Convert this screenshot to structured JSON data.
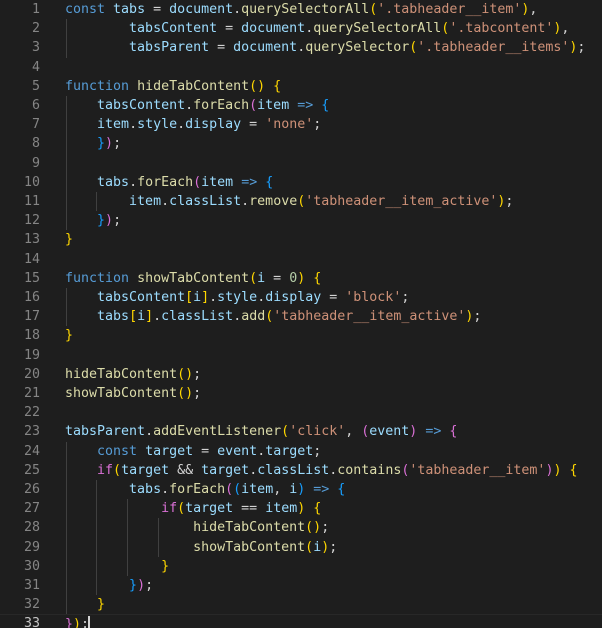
{
  "editor": {
    "theme": "dark-plus",
    "language": "javascript",
    "background": "#1e1e1e",
    "gutter_color": "#858585",
    "active_line_number": 33,
    "cursor": {
      "line": 33,
      "column": 4
    },
    "total_lines": 33,
    "colors": {
      "keyword": "#569cd6",
      "variable": "#9cdcfe",
      "function": "#dcdcaa",
      "string": "#ce9178",
      "number": "#b5cea8",
      "plain": "#d4d4d4",
      "paren_level_1": "#ffd700",
      "paren_level_2": "#da70d6",
      "paren_level_3": "#179fff",
      "indent_guide": "#404040",
      "cursor": "#d4d4d4"
    }
  },
  "lines": [
    {
      "n": 1,
      "guides": [],
      "tokens": [
        {
          "t": "const",
          "c": "t-kw"
        },
        {
          "t": " ",
          "c": "t-plain"
        },
        {
          "t": "tabs",
          "c": "t-var"
        },
        {
          "t": " = ",
          "c": "t-plain"
        },
        {
          "t": "document",
          "c": "t-var"
        },
        {
          "t": ".",
          "c": "t-plain"
        },
        {
          "t": "querySelectorAll",
          "c": "t-fn"
        },
        {
          "t": "(",
          "c": "t-p1"
        },
        {
          "t": "'.tabheader__item'",
          "c": "t-str"
        },
        {
          "t": ")",
          "c": "t-p1"
        },
        {
          "t": ",",
          "c": "t-plain"
        }
      ]
    },
    {
      "n": 2,
      "guides": [
        1
      ],
      "tokens": [
        {
          "t": "        ",
          "c": "t-plain"
        },
        {
          "t": "tabsContent",
          "c": "t-var"
        },
        {
          "t": " = ",
          "c": "t-plain"
        },
        {
          "t": "document",
          "c": "t-var"
        },
        {
          "t": ".",
          "c": "t-plain"
        },
        {
          "t": "querySelectorAll",
          "c": "t-fn"
        },
        {
          "t": "(",
          "c": "t-p1"
        },
        {
          "t": "'.tabcontent'",
          "c": "t-str"
        },
        {
          "t": ")",
          "c": "t-p1"
        },
        {
          "t": ",",
          "c": "t-plain"
        }
      ]
    },
    {
      "n": 3,
      "guides": [
        1
      ],
      "tokens": [
        {
          "t": "        ",
          "c": "t-plain"
        },
        {
          "t": "tabsParent",
          "c": "t-var"
        },
        {
          "t": " = ",
          "c": "t-plain"
        },
        {
          "t": "document",
          "c": "t-var"
        },
        {
          "t": ".",
          "c": "t-plain"
        },
        {
          "t": "querySelector",
          "c": "t-fn"
        },
        {
          "t": "(",
          "c": "t-p1"
        },
        {
          "t": "'.tabheader__items'",
          "c": "t-str"
        },
        {
          "t": ")",
          "c": "t-p1"
        },
        {
          "t": ";",
          "c": "t-plain"
        }
      ]
    },
    {
      "n": 4,
      "guides": [],
      "tokens": []
    },
    {
      "n": 5,
      "guides": [],
      "tokens": [
        {
          "t": "function",
          "c": "t-kw"
        },
        {
          "t": " ",
          "c": "t-plain"
        },
        {
          "t": "hideTabContent",
          "c": "t-fn"
        },
        {
          "t": "()",
          "c": "t-p1"
        },
        {
          "t": " ",
          "c": "t-plain"
        },
        {
          "t": "{",
          "c": "t-p1"
        }
      ]
    },
    {
      "n": 6,
      "guides": [
        1
      ],
      "tokens": [
        {
          "t": "    ",
          "c": "t-plain"
        },
        {
          "t": "tabsContent",
          "c": "t-var"
        },
        {
          "t": ".",
          "c": "t-plain"
        },
        {
          "t": "forEach",
          "c": "t-fn"
        },
        {
          "t": "(",
          "c": "t-p2"
        },
        {
          "t": "item",
          "c": "t-var"
        },
        {
          "t": " ",
          "c": "t-plain"
        },
        {
          "t": "=>",
          "c": "t-kw"
        },
        {
          "t": " ",
          "c": "t-plain"
        },
        {
          "t": "{",
          "c": "t-p3"
        }
      ]
    },
    {
      "n": 7,
      "guides": [
        1
      ],
      "tokens": [
        {
          "t": "    ",
          "c": "t-plain"
        },
        {
          "t": "item",
          "c": "t-var"
        },
        {
          "t": ".",
          "c": "t-plain"
        },
        {
          "t": "style",
          "c": "t-var"
        },
        {
          "t": ".",
          "c": "t-plain"
        },
        {
          "t": "display",
          "c": "t-var"
        },
        {
          "t": " = ",
          "c": "t-plain"
        },
        {
          "t": "'none'",
          "c": "t-str"
        },
        {
          "t": ";",
          "c": "t-plain"
        }
      ]
    },
    {
      "n": 8,
      "guides": [
        1
      ],
      "tokens": [
        {
          "t": "    ",
          "c": "t-plain"
        },
        {
          "t": "}",
          "c": "t-p3"
        },
        {
          "t": ")",
          "c": "t-p2"
        },
        {
          "t": ";",
          "c": "t-plain"
        }
      ]
    },
    {
      "n": 9,
      "guides": [
        1
      ],
      "tokens": []
    },
    {
      "n": 10,
      "guides": [
        1
      ],
      "tokens": [
        {
          "t": "    ",
          "c": "t-plain"
        },
        {
          "t": "tabs",
          "c": "t-var"
        },
        {
          "t": ".",
          "c": "t-plain"
        },
        {
          "t": "forEach",
          "c": "t-fn"
        },
        {
          "t": "(",
          "c": "t-p2"
        },
        {
          "t": "item",
          "c": "t-var"
        },
        {
          "t": " ",
          "c": "t-plain"
        },
        {
          "t": "=>",
          "c": "t-kw"
        },
        {
          "t": " ",
          "c": "t-plain"
        },
        {
          "t": "{",
          "c": "t-p3"
        }
      ]
    },
    {
      "n": 11,
      "guides": [
        1,
        2
      ],
      "tokens": [
        {
          "t": "        ",
          "c": "t-plain"
        },
        {
          "t": "item",
          "c": "t-var"
        },
        {
          "t": ".",
          "c": "t-plain"
        },
        {
          "t": "classList",
          "c": "t-var"
        },
        {
          "t": ".",
          "c": "t-plain"
        },
        {
          "t": "remove",
          "c": "t-fn"
        },
        {
          "t": "(",
          "c": "t-p1"
        },
        {
          "t": "'tabheader__item_active'",
          "c": "t-str"
        },
        {
          "t": ")",
          "c": "t-p1"
        },
        {
          "t": ";",
          "c": "t-plain"
        }
      ]
    },
    {
      "n": 12,
      "guides": [
        1
      ],
      "tokens": [
        {
          "t": "    ",
          "c": "t-plain"
        },
        {
          "t": "}",
          "c": "t-p3"
        },
        {
          "t": ")",
          "c": "t-p2"
        },
        {
          "t": ";",
          "c": "t-plain"
        }
      ]
    },
    {
      "n": 13,
      "guides": [],
      "tokens": [
        {
          "t": "}",
          "c": "t-p1"
        }
      ]
    },
    {
      "n": 14,
      "guides": [],
      "tokens": []
    },
    {
      "n": 15,
      "guides": [],
      "tokens": [
        {
          "t": "function",
          "c": "t-kw"
        },
        {
          "t": " ",
          "c": "t-plain"
        },
        {
          "t": "showTabContent",
          "c": "t-fn"
        },
        {
          "t": "(",
          "c": "t-p1"
        },
        {
          "t": "i",
          "c": "t-var"
        },
        {
          "t": " = ",
          "c": "t-plain"
        },
        {
          "t": "0",
          "c": "t-num"
        },
        {
          "t": ")",
          "c": "t-p1"
        },
        {
          "t": " ",
          "c": "t-plain"
        },
        {
          "t": "{",
          "c": "t-p1"
        }
      ]
    },
    {
      "n": 16,
      "guides": [
        1
      ],
      "tokens": [
        {
          "t": "    ",
          "c": "t-plain"
        },
        {
          "t": "tabsContent",
          "c": "t-var"
        },
        {
          "t": "[",
          "c": "t-p1"
        },
        {
          "t": "i",
          "c": "t-var"
        },
        {
          "t": "]",
          "c": "t-p1"
        },
        {
          "t": ".",
          "c": "t-plain"
        },
        {
          "t": "style",
          "c": "t-var"
        },
        {
          "t": ".",
          "c": "t-plain"
        },
        {
          "t": "display",
          "c": "t-var"
        },
        {
          "t": " = ",
          "c": "t-plain"
        },
        {
          "t": "'block'",
          "c": "t-str"
        },
        {
          "t": ";",
          "c": "t-plain"
        }
      ]
    },
    {
      "n": 17,
      "guides": [
        1
      ],
      "tokens": [
        {
          "t": "    ",
          "c": "t-plain"
        },
        {
          "t": "tabs",
          "c": "t-var"
        },
        {
          "t": "[",
          "c": "t-p1"
        },
        {
          "t": "i",
          "c": "t-var"
        },
        {
          "t": "]",
          "c": "t-p1"
        },
        {
          "t": ".",
          "c": "t-plain"
        },
        {
          "t": "classList",
          "c": "t-var"
        },
        {
          "t": ".",
          "c": "t-plain"
        },
        {
          "t": "add",
          "c": "t-fn"
        },
        {
          "t": "(",
          "c": "t-p1"
        },
        {
          "t": "'tabheader__item_active'",
          "c": "t-str"
        },
        {
          "t": ")",
          "c": "t-p1"
        },
        {
          "t": ";",
          "c": "t-plain"
        }
      ]
    },
    {
      "n": 18,
      "guides": [],
      "tokens": [
        {
          "t": "}",
          "c": "t-p1"
        }
      ]
    },
    {
      "n": 19,
      "guides": [],
      "tokens": []
    },
    {
      "n": 20,
      "guides": [],
      "tokens": [
        {
          "t": "hideTabContent",
          "c": "t-fn"
        },
        {
          "t": "()",
          "c": "t-p1"
        },
        {
          "t": ";",
          "c": "t-plain"
        }
      ]
    },
    {
      "n": 21,
      "guides": [],
      "tokens": [
        {
          "t": "showTabContent",
          "c": "t-fn"
        },
        {
          "t": "()",
          "c": "t-p1"
        },
        {
          "t": ";",
          "c": "t-plain"
        }
      ]
    },
    {
      "n": 22,
      "guides": [],
      "tokens": []
    },
    {
      "n": 23,
      "guides": [],
      "tokens": [
        {
          "t": "tabsParent",
          "c": "t-var"
        },
        {
          "t": ".",
          "c": "t-plain"
        },
        {
          "t": "addEventListener",
          "c": "t-fn"
        },
        {
          "t": "(",
          "c": "t-p1"
        },
        {
          "t": "'click'",
          "c": "t-str"
        },
        {
          "t": ", ",
          "c": "t-plain"
        },
        {
          "t": "(",
          "c": "t-p2"
        },
        {
          "t": "event",
          "c": "t-var"
        },
        {
          "t": ")",
          "c": "t-p2"
        },
        {
          "t": " ",
          "c": "t-plain"
        },
        {
          "t": "=>",
          "c": "t-kw"
        },
        {
          "t": " ",
          "c": "t-plain"
        },
        {
          "t": "{",
          "c": "t-p2"
        }
      ]
    },
    {
      "n": 24,
      "guides": [
        1
      ],
      "tokens": [
        {
          "t": "    ",
          "c": "t-plain"
        },
        {
          "t": "const",
          "c": "t-kw"
        },
        {
          "t": " ",
          "c": "t-plain"
        },
        {
          "t": "target",
          "c": "t-var"
        },
        {
          "t": " = ",
          "c": "t-plain"
        },
        {
          "t": "event",
          "c": "t-var"
        },
        {
          "t": ".",
          "c": "t-plain"
        },
        {
          "t": "target",
          "c": "t-var"
        },
        {
          "t": ";",
          "c": "t-plain"
        }
      ]
    },
    {
      "n": 25,
      "guides": [
        1
      ],
      "tokens": [
        {
          "t": "    ",
          "c": "t-plain"
        },
        {
          "t": "if",
          "c": "t-p2"
        },
        {
          "t": "(",
          "c": "t-p1"
        },
        {
          "t": "target",
          "c": "t-var"
        },
        {
          "t": " && ",
          "c": "t-plain"
        },
        {
          "t": "target",
          "c": "t-var"
        },
        {
          "t": ".",
          "c": "t-plain"
        },
        {
          "t": "classList",
          "c": "t-var"
        },
        {
          "t": ".",
          "c": "t-plain"
        },
        {
          "t": "contains",
          "c": "t-fn"
        },
        {
          "t": "(",
          "c": "t-p2"
        },
        {
          "t": "'tabheader__item'",
          "c": "t-str"
        },
        {
          "t": ")",
          "c": "t-p2"
        },
        {
          "t": ")",
          "c": "t-p1"
        },
        {
          "t": " ",
          "c": "t-plain"
        },
        {
          "t": "{",
          "c": "t-p1"
        }
      ]
    },
    {
      "n": 26,
      "guides": [
        1,
        2
      ],
      "tokens": [
        {
          "t": "        ",
          "c": "t-plain"
        },
        {
          "t": "tabs",
          "c": "t-var"
        },
        {
          "t": ".",
          "c": "t-plain"
        },
        {
          "t": "forEach",
          "c": "t-fn"
        },
        {
          "t": "(",
          "c": "t-p2"
        },
        {
          "t": "(",
          "c": "t-p3"
        },
        {
          "t": "item",
          "c": "t-var"
        },
        {
          "t": ", ",
          "c": "t-plain"
        },
        {
          "t": "i",
          "c": "t-var"
        },
        {
          "t": ")",
          "c": "t-p3"
        },
        {
          "t": " ",
          "c": "t-plain"
        },
        {
          "t": "=>",
          "c": "t-kw"
        },
        {
          "t": " ",
          "c": "t-plain"
        },
        {
          "t": "{",
          "c": "t-p3"
        }
      ]
    },
    {
      "n": 27,
      "guides": [
        1,
        2,
        3
      ],
      "tokens": [
        {
          "t": "            ",
          "c": "t-plain"
        },
        {
          "t": "if",
          "c": "t-p2"
        },
        {
          "t": "(",
          "c": "t-p1"
        },
        {
          "t": "target",
          "c": "t-var"
        },
        {
          "t": " == ",
          "c": "t-plain"
        },
        {
          "t": "item",
          "c": "t-var"
        },
        {
          "t": ")",
          "c": "t-p1"
        },
        {
          "t": " ",
          "c": "t-plain"
        },
        {
          "t": "{",
          "c": "t-p1"
        }
      ]
    },
    {
      "n": 28,
      "guides": [
        1,
        2,
        3,
        4
      ],
      "tokens": [
        {
          "t": "                ",
          "c": "t-plain"
        },
        {
          "t": "hideTabContent",
          "c": "t-fn"
        },
        {
          "t": "()",
          "c": "t-p1"
        },
        {
          "t": ";",
          "c": "t-plain"
        }
      ]
    },
    {
      "n": 29,
      "guides": [
        1,
        2,
        3,
        4
      ],
      "tokens": [
        {
          "t": "                ",
          "c": "t-plain"
        },
        {
          "t": "showTabContent",
          "c": "t-fn"
        },
        {
          "t": "(",
          "c": "t-p1"
        },
        {
          "t": "i",
          "c": "t-var"
        },
        {
          "t": ")",
          "c": "t-p1"
        },
        {
          "t": ";",
          "c": "t-plain"
        }
      ]
    },
    {
      "n": 30,
      "guides": [
        1,
        2,
        3
      ],
      "tokens": [
        {
          "t": "            ",
          "c": "t-plain"
        },
        {
          "t": "}",
          "c": "t-p1"
        }
      ]
    },
    {
      "n": 31,
      "guides": [
        1,
        2
      ],
      "tokens": [
        {
          "t": "        ",
          "c": "t-plain"
        },
        {
          "t": "}",
          "c": "t-p3"
        },
        {
          "t": ")",
          "c": "t-p2"
        },
        {
          "t": ";",
          "c": "t-plain"
        }
      ]
    },
    {
      "n": 32,
      "guides": [
        1
      ],
      "tokens": [
        {
          "t": "    ",
          "c": "t-plain"
        },
        {
          "t": "}",
          "c": "t-p1"
        }
      ]
    },
    {
      "n": 33,
      "guides": [],
      "active": true,
      "cursor_col": 3,
      "tokens": [
        {
          "t": "}",
          "c": "t-p2"
        },
        {
          "t": ")",
          "c": "t-p1"
        },
        {
          "t": ";",
          "c": "t-plain"
        }
      ]
    }
  ]
}
